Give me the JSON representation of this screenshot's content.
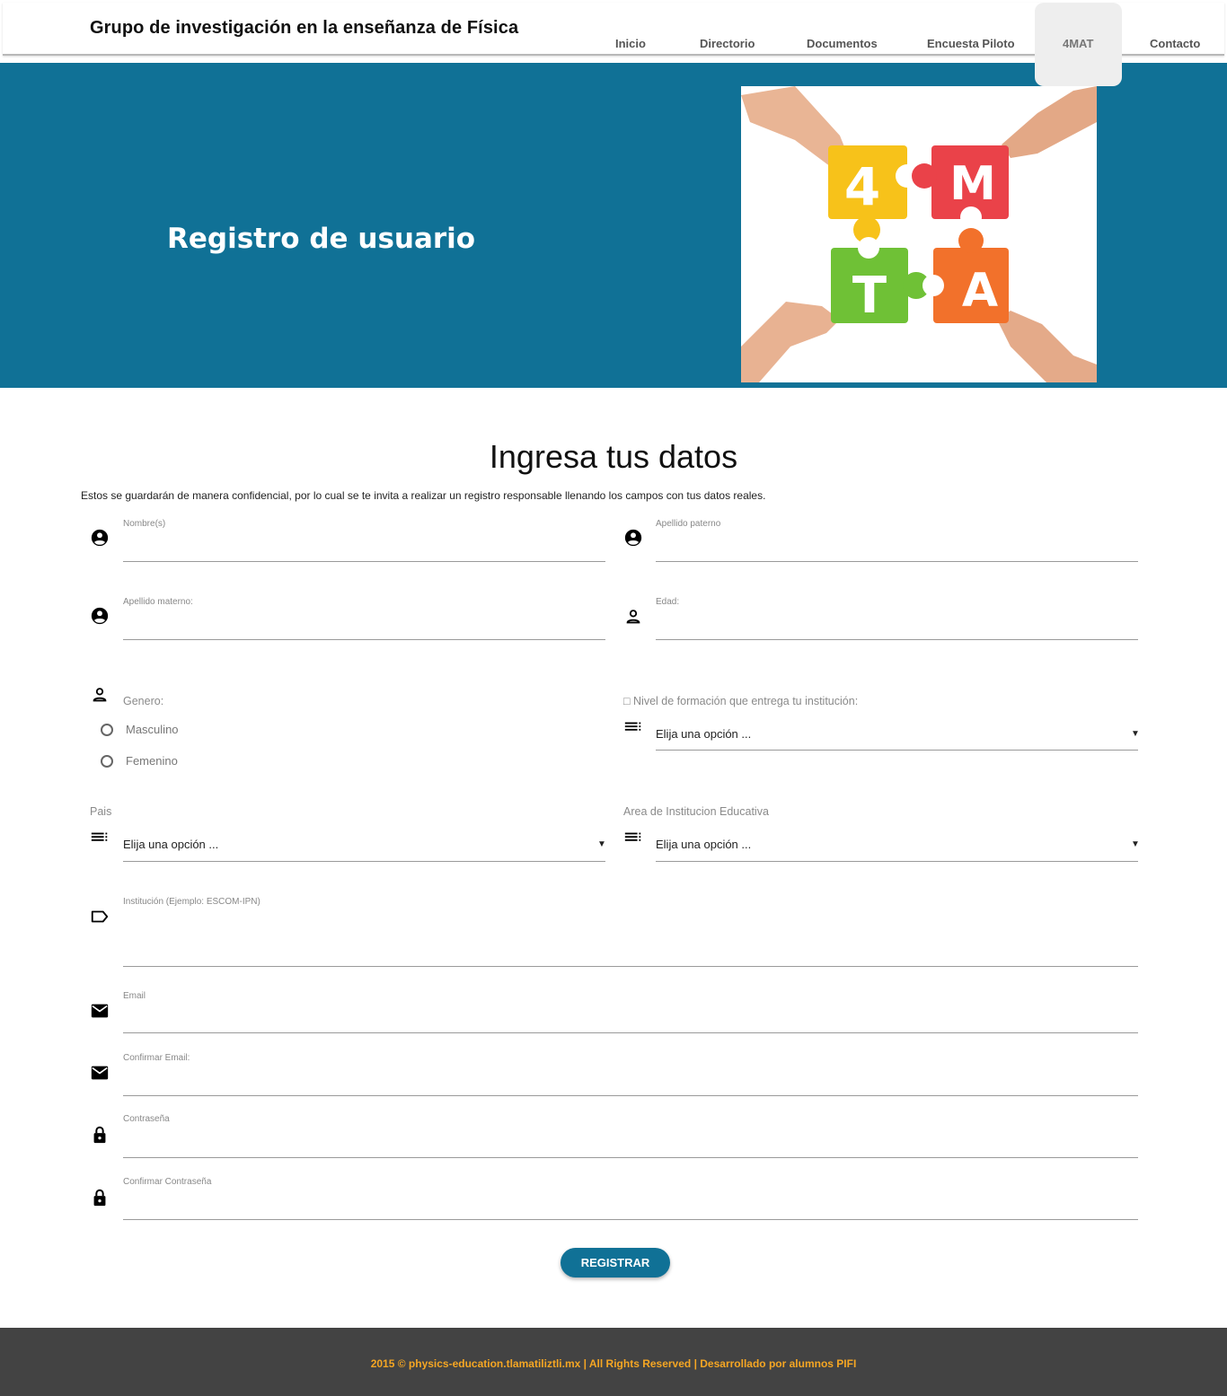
{
  "header": {
    "site_title": "Grupo de investigación en la enseñanza de Física",
    "nav": [
      "Inicio",
      "Directorio",
      "Documentos",
      "Encuesta Piloto",
      "4MAT",
      "Contacto"
    ],
    "active_nav": "4MAT"
  },
  "banner": {
    "title": "Registro de usuario",
    "image_letters": [
      "4",
      "M",
      "T",
      "A"
    ]
  },
  "form": {
    "title": "Ingresa tus datos",
    "intro": "Estos se guardarán de manera confidencial, por lo cual se te invita a realizar un registro responsable llenando los campos con tus datos reales.",
    "nombre_label": "Nombre(s)",
    "apellido_paterno_label": "Apellido paterno",
    "apellido_materno_label": "Apellido materno:",
    "edad_label": "Edad:",
    "genero_label": "Genero:",
    "genero_options": [
      "Masculino",
      "Femenino"
    ],
    "nivel_label": "□ Nivel de formación que entrega tu institución:",
    "nivel_value": "Elija una opción ...",
    "pais_label": "Pais",
    "pais_value": "Elija una opción ...",
    "area_label": "Area de Institucion Educativa",
    "area_value": "Elija una opción ...",
    "institucion_label": "Institución (Ejemplo: ESCOM-IPN)",
    "email_label": "Email",
    "confirm_email_label": "Confirmar Email:",
    "password_label": "Contraseña",
    "confirm_password_label": "Confirmar Contraseña",
    "submit_label": "REGISTRAR"
  },
  "footer": {
    "text": "2015 © physics-education.tlamatiliztli.mx | All Rights Reserved | Desarrollado por alumnos PIFI"
  },
  "colors": {
    "primary": "#107196",
    "footer_bg": "#434343",
    "footer_text": "#f5a623"
  }
}
